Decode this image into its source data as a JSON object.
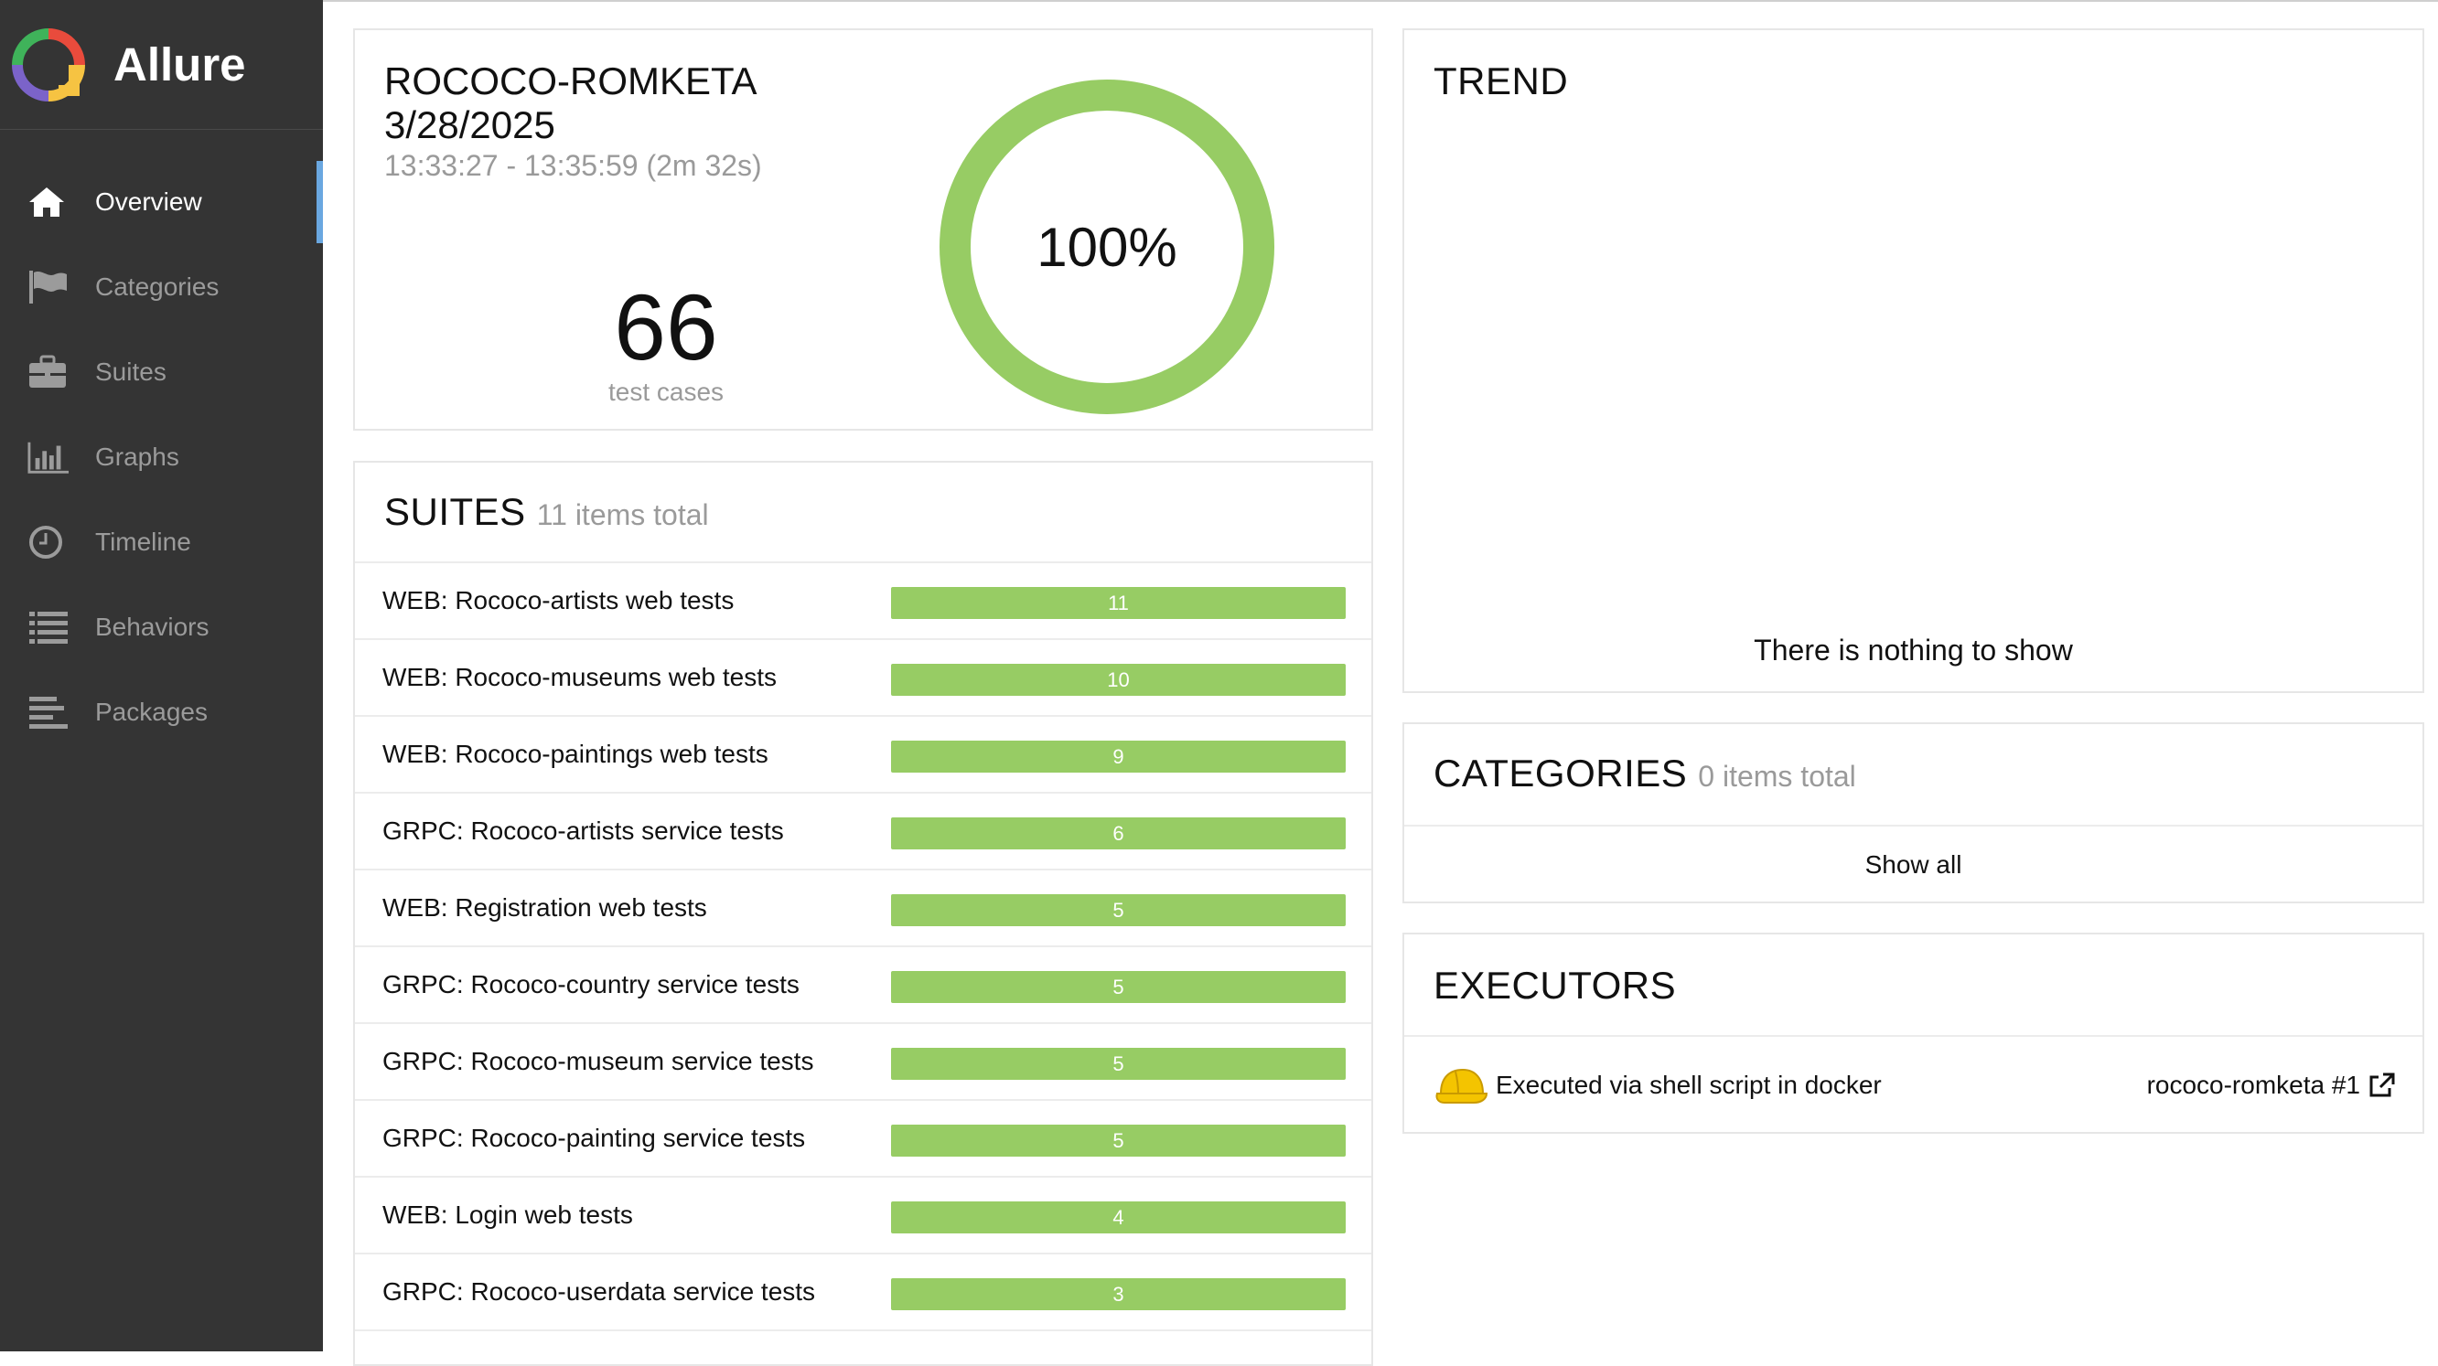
{
  "sidebar": {
    "brand": "Allure",
    "items": [
      {
        "label": "Overview",
        "icon": "home-icon",
        "active": true
      },
      {
        "label": "Categories",
        "icon": "flag-icon",
        "active": false
      },
      {
        "label": "Suites",
        "icon": "briefcase-icon",
        "active": false
      },
      {
        "label": "Graphs",
        "icon": "bar-chart-icon",
        "active": false
      },
      {
        "label": "Timeline",
        "icon": "clock-icon",
        "active": false
      },
      {
        "label": "Behaviors",
        "icon": "list-icon",
        "active": false
      },
      {
        "label": "Packages",
        "icon": "align-left-icon",
        "active": false
      }
    ]
  },
  "summary": {
    "report_name": "ROCOCO-ROMKETA",
    "date": "3/28/2025",
    "time_range": "13:33:27 - 13:35:59 (2m 32s)",
    "test_count": "66",
    "test_count_label": "test cases",
    "pass_rate": "100%"
  },
  "suites": {
    "title": "SUITES",
    "total": "11 items total",
    "rows": [
      {
        "name": "WEB: Rococo-artists web tests",
        "count": "11"
      },
      {
        "name": "WEB: Rococo-museums web tests",
        "count": "10"
      },
      {
        "name": "WEB: Rococo-paintings web tests",
        "count": "9"
      },
      {
        "name": "GRPC: Rococo-artists service tests",
        "count": "6"
      },
      {
        "name": "WEB: Registration web tests",
        "count": "5"
      },
      {
        "name": "GRPC: Rococo-country service tests",
        "count": "5"
      },
      {
        "name": "GRPC: Rococo-museum service tests",
        "count": "5"
      },
      {
        "name": "GRPC: Rococo-painting service tests",
        "count": "5"
      },
      {
        "name": "WEB: Login web tests",
        "count": "4"
      },
      {
        "name": "GRPC: Rococo-userdata service tests",
        "count": "3"
      }
    ]
  },
  "trend": {
    "title": "TREND",
    "empty_message": "There is nothing to show"
  },
  "categories": {
    "title": "CATEGORIES",
    "total": "0 items total",
    "show_all": "Show all"
  },
  "executors": {
    "title": "EXECUTORS",
    "name": "Executed via shell script in docker",
    "build": "rococo-romketa #1",
    "icon": "hard-hat-icon",
    "link_icon": "external-link-icon"
  },
  "colors": {
    "sidebar_bg": "#343434",
    "passed_green": "#97cc64",
    "active_accent": "#6aa7e0"
  }
}
